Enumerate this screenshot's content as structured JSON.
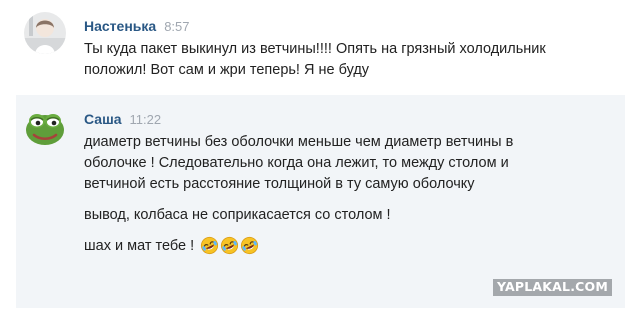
{
  "messages": [
    {
      "author": "Настенька",
      "time": "8:57",
      "avatar_icon": "user-photo-avatar",
      "paragraphs": [
        "Ты куда пакет выкинул из ветчины!!!! Опять на грязный холодильник положил! Вот сам и жри теперь! Я не буду"
      ]
    },
    {
      "author": "Саша",
      "time": "11:22",
      "avatar_icon": "pepe-frog-avatar",
      "paragraphs": [
        "диаметр ветчины без оболочки меньше чем диаметр ветчины в оболочке ! Следовательно когда она лежит, то между столом и ветчиной есть расстояние толщиной в ту самую оболочку",
        "вывод, колбаса не соприкасается со столом !",
        "шах и мат тебе !"
      ],
      "emojis": [
        "rofl-emoji",
        "rofl-emoji",
        "rofl-emoji"
      ]
    }
  ],
  "watermark": "YAPLAKAL.COM",
  "colors": {
    "author_link": "#2a5885",
    "timestamp": "#a0a7b0",
    "highlight_background": "#f2f5f8",
    "watermark_background": "#a4a8ac"
  }
}
